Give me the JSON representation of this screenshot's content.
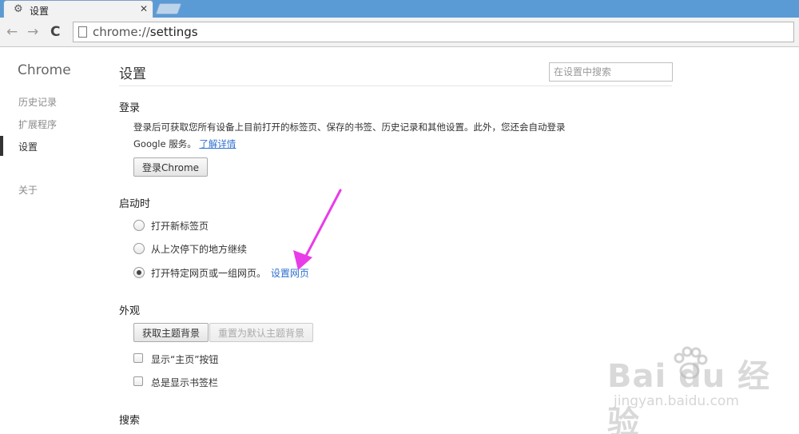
{
  "tab": {
    "title": "设置",
    "icon": "gear-icon",
    "close_icon": "close-icon"
  },
  "toolbar": {
    "back_icon": "back-arrow-icon",
    "forward_icon": "forward-arrow-icon",
    "reload_icon": "reload-icon",
    "url_scheme": "chrome://",
    "url_host": "settings"
  },
  "sidebar": {
    "brand": "Chrome",
    "items": [
      {
        "label": "历史记录",
        "active": false
      },
      {
        "label": "扩展程序",
        "active": false
      },
      {
        "label": "设置",
        "active": true
      },
      {
        "label": "关于",
        "active": false
      }
    ]
  },
  "main": {
    "title": "设置",
    "search_placeholder": "在设置中搜索",
    "signin": {
      "heading": "登录",
      "desc_line1": "登录后可获取您所有设备上目前打开的标签页、保存的书签、历史记录和其他设置。此外，您还会自动登录",
      "desc_line2": "Google 服务。",
      "learn_more": "了解详情",
      "button": "登录Chrome"
    },
    "startup": {
      "heading": "启动时",
      "options": [
        {
          "label": "打开新标签页",
          "checked": false
        },
        {
          "label": "从上次停下的地方继续",
          "checked": false
        },
        {
          "label": "打开特定网页或一组网页。",
          "checked": true
        }
      ],
      "set_pages_link": "设置网页"
    },
    "appearance": {
      "heading": "外观",
      "get_themes": "获取主题背景",
      "reset_theme": "重置为默认主题背景",
      "show_home": "显示“主页”按钮",
      "show_bookmarks": "总是显示书签栏"
    },
    "search_section": {
      "heading": "搜索"
    }
  },
  "annotation": {
    "arrow_color": "#e83ce8"
  },
  "watermark": {
    "logo": "Bai du 经验",
    "sub": "jingyan.baidu.com"
  },
  "colors": {
    "tabstrip": "#5b9bd5",
    "link": "#2f6fd0"
  }
}
